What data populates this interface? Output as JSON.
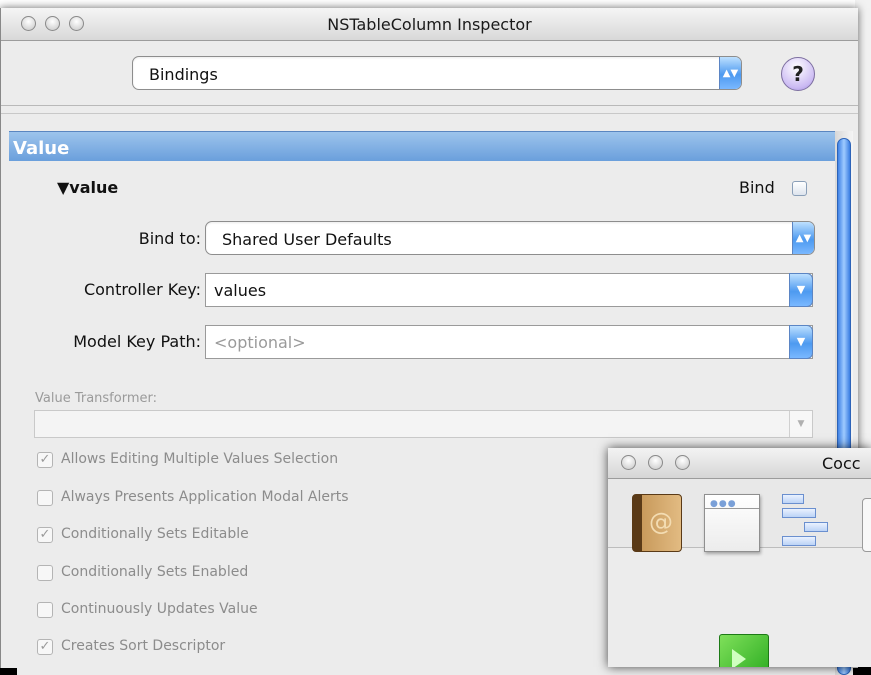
{
  "inspector": {
    "title": "NSTableColumn Inspector",
    "mode_popup": "Bindings",
    "help_glyph": "?",
    "section_title": "Value",
    "binding": {
      "name": "▼value",
      "bind_label": "Bind",
      "bind_checked": false,
      "bind_to_label": "Bind to:",
      "bind_to_value": "Shared User Defaults",
      "controller_key_label": "Controller Key:",
      "controller_key_value": "values",
      "model_key_path_label": "Model Key Path:",
      "model_key_path_placeholder": "<optional>",
      "value_transformer_label": "Value Transformer:",
      "value_transformer_value": ""
    },
    "options": [
      {
        "label": "Allows Editing Multiple Values Selection",
        "checked": true
      },
      {
        "label": "Always Presents Application Modal Alerts",
        "checked": false
      },
      {
        "label": "Conditionally Sets Editable",
        "checked": true
      },
      {
        "label": "Conditionally Sets Enabled",
        "checked": false
      },
      {
        "label": "Continuously Updates Value",
        "checked": false
      },
      {
        "label": "Creates Sort Descriptor",
        "checked": true
      }
    ]
  },
  "palette_window": {
    "title_fragment": "Cocc"
  },
  "glyphs": {
    "check": "✓",
    "updown": "▲▼",
    "down": "▼",
    "at": "@"
  },
  "colors": {
    "accent": "#4d9af0",
    "section_header": "#7fadE2",
    "disabled_text": "#8c8c8c"
  }
}
